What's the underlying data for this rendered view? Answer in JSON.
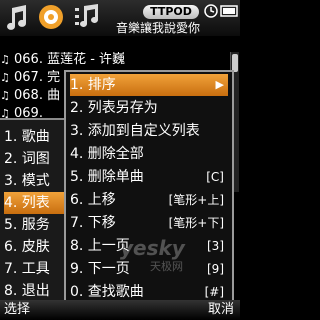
{
  "topbar": {
    "icons": [
      "music-note-icon",
      "disc-icon",
      "playlist-icon"
    ],
    "brand": "TTPOD",
    "ticker": "音樂讓我說愛你"
  },
  "playlist": {
    "rows": [
      {
        "num": "066.",
        "title": "蓝莲花 - 许巍"
      },
      {
        "num": "067.",
        "title": "完"
      },
      {
        "num": "068.",
        "title": "曲"
      },
      {
        "num": "069.",
        "title": ""
      }
    ]
  },
  "leftmenu": {
    "items": [
      {
        "label": "1. 歌曲"
      },
      {
        "label": "2. 词图"
      },
      {
        "label": "3. 模式"
      },
      {
        "label": "4. 列表"
      },
      {
        "label": "5. 服务"
      },
      {
        "label": "6. 皮肤"
      },
      {
        "label": "7. 工具"
      },
      {
        "label": "8. 退出"
      }
    ],
    "selected": 3
  },
  "submenu": {
    "items": [
      {
        "label": "1. 排序",
        "key": ""
      },
      {
        "label": "2. 列表另存为",
        "key": ""
      },
      {
        "label": "3. 添加到自定义列表",
        "key": ""
      },
      {
        "label": "4. 删除全部",
        "key": ""
      },
      {
        "label": "5. 删除单曲",
        "key": "[C]"
      },
      {
        "label": "6. 上移",
        "key": "[笔形+上]"
      },
      {
        "label": "7. 下移",
        "key": "[笔形+下]"
      },
      {
        "label": "8. 上一页",
        "key": "[3]"
      },
      {
        "label": "9. 下一页",
        "key": "[9]"
      },
      {
        "label": "0. 查找歌曲",
        "key": "[#]"
      }
    ],
    "selected": 0
  },
  "softkeys": {
    "left": "选择",
    "right": "取消"
  },
  "watermark": {
    "main": "yesky",
    "sub": "天极网"
  },
  "colors": {
    "highlight": "#e08a25",
    "background": "#000000"
  }
}
